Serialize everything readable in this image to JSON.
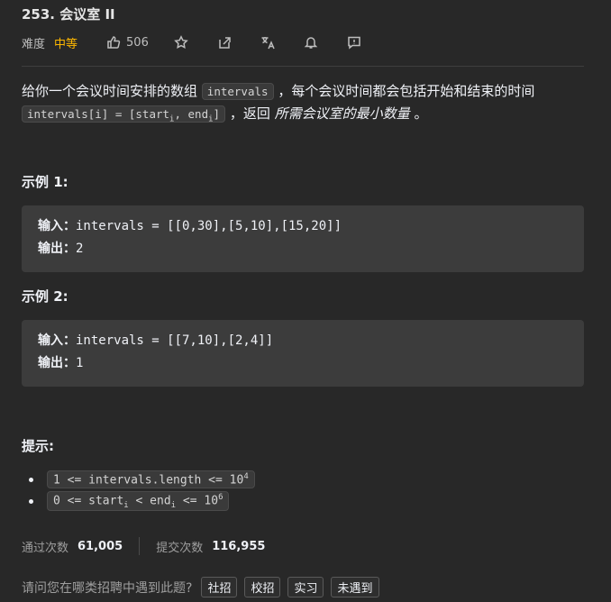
{
  "problem": {
    "title": "253. 会议室 II",
    "difficulty_label": "难度",
    "difficulty": "中等",
    "likes": "506"
  },
  "description": {
    "p1": "给你一个会议时间安排的数组",
    "code1": "intervals",
    "p2": "，每个会议时间都会包括开始和结束的时间",
    "code2_a": "intervals[i] = [start",
    "code2_sub1": "i",
    "code2_b": ", end",
    "code2_sub2": "i",
    "code2_c": "]",
    "p3": "，返回",
    "emph": "所需会议室的最小数量",
    "p4": "。"
  },
  "examples": [
    {
      "title": "示例 1:",
      "input_label": "输入：",
      "input": "intervals = [[0,30],[5,10],[15,20]]",
      "output_label": "输出：",
      "output": "2"
    },
    {
      "title": "示例 2:",
      "input_label": "输入：",
      "input": "intervals = [[7,10],[2,4]]",
      "output_label": "输出：",
      "output": "1"
    }
  ],
  "hints": {
    "title": "提示:",
    "h1_a": "1 <=  intervals.length <= 10",
    "h1_sup": "4",
    "h2_a": "0 <= start",
    "h2_sub": "i",
    "h2_b": " < end",
    "h2_sub2": "i",
    "h2_c": " <= 10",
    "h2_sup": "6"
  },
  "stats": {
    "accepted_label": "通过次数",
    "accepted": "61,005",
    "submissions_label": "提交次数",
    "submissions": "116,955"
  },
  "survey": {
    "question": "请问您在哪类招聘中遇到此题?",
    "options": [
      "社招",
      "校招",
      "实习",
      "未遇到"
    ]
  },
  "icons": {
    "like": "thumbs-up-icon",
    "star": "star-icon",
    "share": "share-icon",
    "translate": "translate-icon",
    "bell": "bell-icon",
    "feedback": "feedback-icon"
  }
}
